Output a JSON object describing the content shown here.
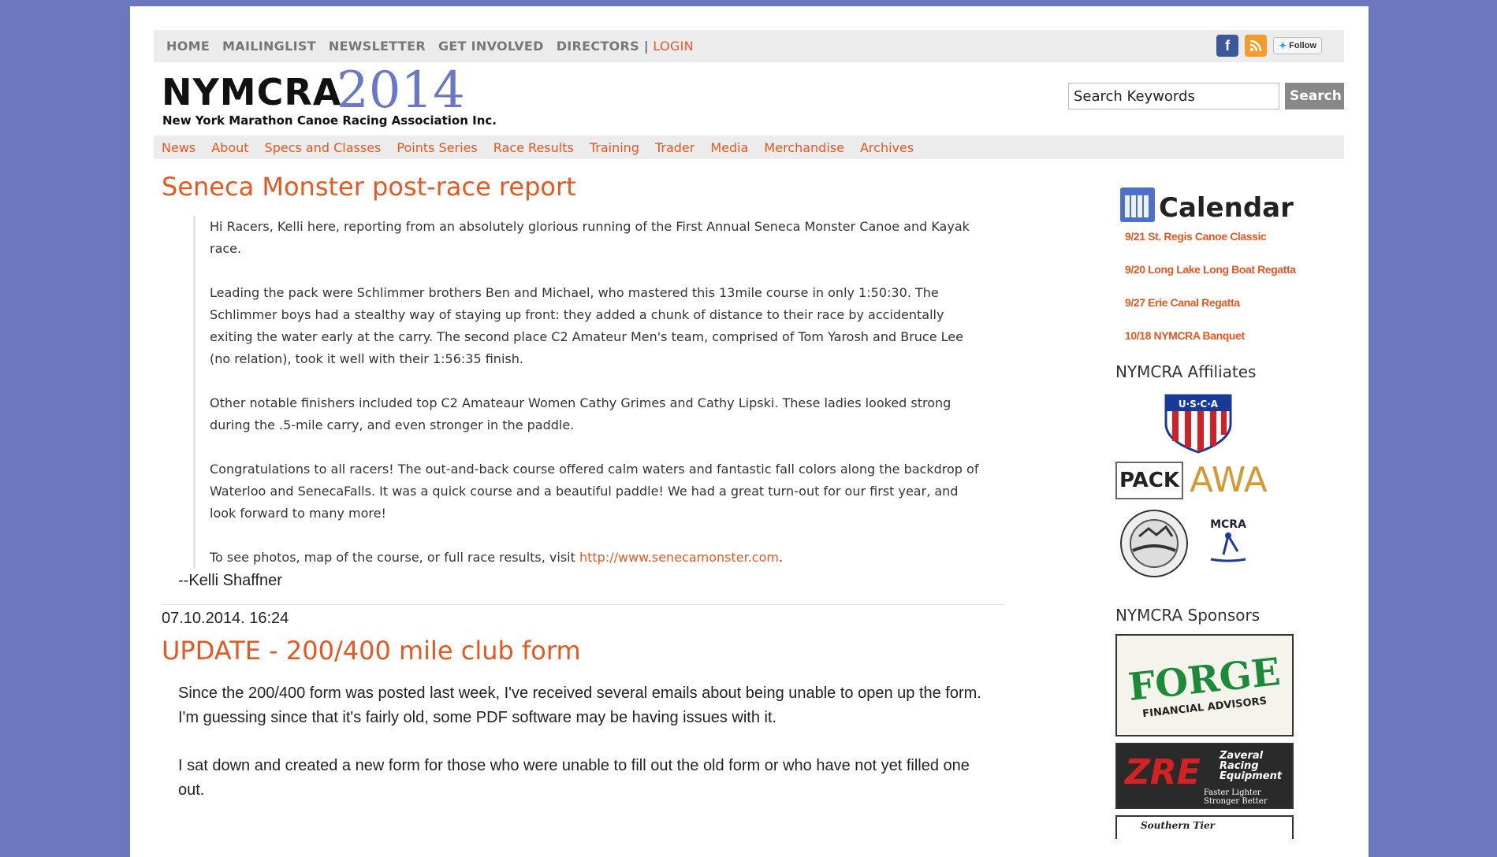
{
  "topnav": {
    "items": [
      "HOME",
      "MAILINGLIST",
      "NEWSLETTER",
      "GET INVOLVED",
      "DIRECTORS"
    ],
    "separator": "|",
    "login": "LOGIN"
  },
  "social": {
    "facebook": "f",
    "rss": "rss",
    "twitter_label": "Follow"
  },
  "logo": {
    "name": "NYMCRA",
    "year": "2014",
    "subtitle": "New York Marathon Canoe Racing Association Inc."
  },
  "search": {
    "value": "Search Keywords",
    "button": "Search"
  },
  "mainnav": [
    "News",
    "About",
    "Specs and Classes",
    "Points Series",
    "Race Results",
    "Training",
    "Trader",
    "Media",
    "Merchandise",
    "Archives"
  ],
  "posts": [
    {
      "title": "Seneca Monster post-race report",
      "paragraphs": [
        "Hi Racers, Kelli here, reporting from an absolutely glorious running of the First Annual Seneca Monster Canoe and Kayak race.",
        "Leading the pack were Schlimmer brothers Ben and Michael, who mastered this 13mile course in only 1:50:30. The Schlimmer boys had a stealthy way of staying up front: they added a chunk of distance to their race by accidentally exiting the water early at the carry. The second place C2 Amateur Men's team, comprised of Tom Yarosh and Bruce Lee (no relation), took it well with their 1:56:35 finish.",
        "Other notable finishers included top C2 Amateaur Women Cathy Grimes and Cathy Lipski. These ladies looked strong during the .5-mile carry, and even stronger in the paddle.",
        "Congratulations to all racers! The out-and-back course offered calm waters and fantastic fall colors along the backdrop of Waterloo and SenecaFalls. It was a quick course and a beautiful paddle! We had a great turn-out for our first year, and look forward to many more!"
      ],
      "link_prefix": "To see photos, map of the course, or full race results, visit ",
      "link_text": "http://www.senecamonster.com",
      "link_suffix": ".",
      "signature": "--Kelli Shaffner"
    },
    {
      "date": "07.10.2014. 16:24",
      "title": "UPDATE - 200/400 mile club form",
      "paragraphs": [
        "Since the 200/400 form was posted last week, I've received several emails about being unable to open up the form. I'm guessing since that it's fairly old, some PDF software may be having issues with it.",
        "I sat down and created a new form for those who were unable to fill out the old form or who have not yet filled one out."
      ]
    }
  ],
  "sidebar": {
    "calendar_title": "Calendar",
    "events": [
      "9/21 St. Regis Canoe Classic",
      "9/20 Long Lake Long Boat Regatta",
      "9/27 Erie Canal Regatta",
      "10/18 NYMCRA Banquet"
    ],
    "affiliates_title": "NYMCRA Affiliates",
    "affiliates": {
      "usca": "U·S·C·A",
      "pack": "PACK",
      "awa": "AWA",
      "mcra": "MCRA"
    },
    "sponsors_title": "NYMCRA Sponsors",
    "sponsors": {
      "forge": "FORGE",
      "forge_sub": "FINANCIAL ADVISORS",
      "zre": "ZRE",
      "zre_text": "Zaveral Racing Equipment",
      "zre_tag": "Faster Lighter Stronger Better",
      "southern": "Southern Tier"
    }
  }
}
